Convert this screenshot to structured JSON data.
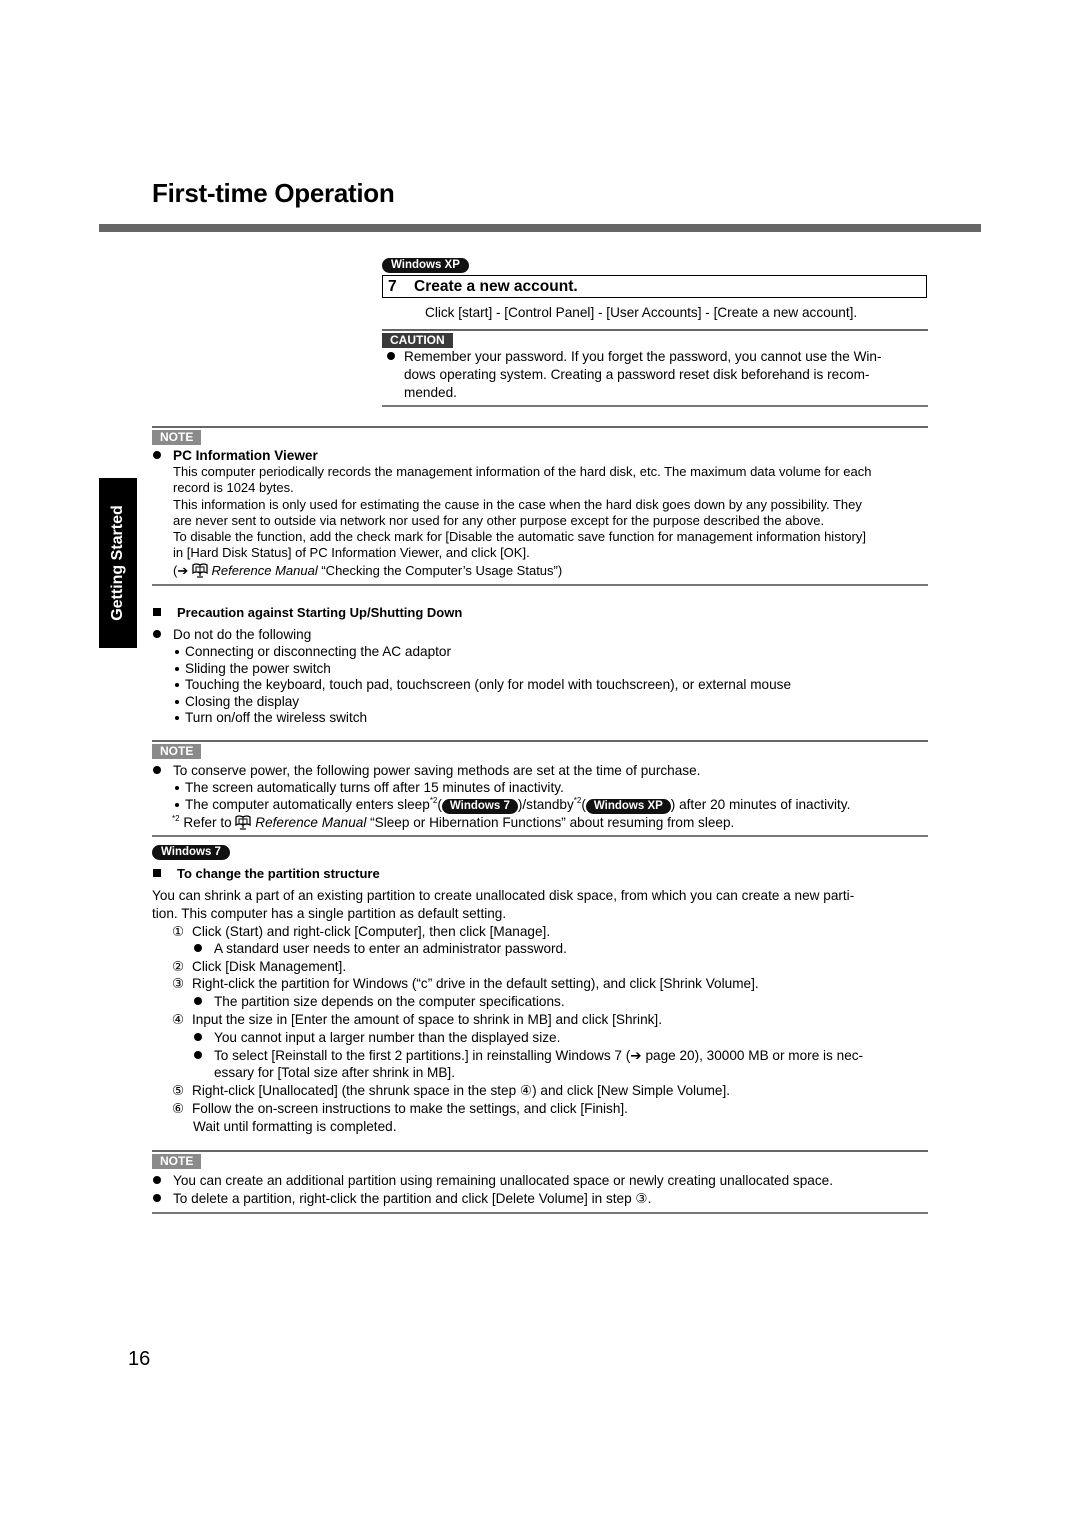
{
  "page": {
    "title": "First-time Operation",
    "side_tab": "Getting Started",
    "page_number": "16"
  },
  "badges": {
    "windows_xp": "Windows XP",
    "windows_7": "Windows 7"
  },
  "step7": {
    "number": "7",
    "title": "Create a new account.",
    "instruction": "Click [start] - [Control Panel] - [User Accounts] - [Create a new account]."
  },
  "caution": {
    "label": "CAUTION",
    "lines": [
      "Remember your password. If you forget the password, you cannot use the Win-",
      "dows operating system. Creating a password reset disk beforehand is recom-",
      "mended."
    ]
  },
  "note1": {
    "label": "NOTE",
    "heading": "PC Information Viewer",
    "lines": [
      "This computer periodically records the management information of the hard disk, etc. The maximum data volume for each",
      "record is 1024 bytes.",
      "This information is only used for estimating the cause in the case when the hard disk goes down by any possibility. They",
      "are never sent to outside via network nor used for any other purpose except for the purpose described the above.",
      "To disable the function, add the check mark for [Disable the automatic save function for management information history]",
      "in [Hard Disk Status] of PC Information Viewer, and click [OK]."
    ],
    "ref_open": "(",
    "ref_arrow": "➔",
    "ref_manual": "Reference Manual",
    "ref_topic": " “Checking the Computer’s Usage Status”)"
  },
  "precaution": {
    "heading": "Precaution against Starting Up/Shutting Down",
    "intro": "Do not do the following",
    "items": [
      "Connecting or disconnecting the AC adaptor",
      "Sliding the power switch",
      "Touching the keyboard, touch pad, touchscreen (only for model with touchscreen), or external mouse",
      "Closing the display",
      "Turn on/off the wireless switch"
    ]
  },
  "note2": {
    "label": "NOTE",
    "intro": "To conserve power, the following power saving methods are set at the time of purchase.",
    "item1": "The screen automatically turns off after 15 minutes of inactivity.",
    "item2_a": "The computer automatically enters sleep",
    "item2_sup": "*2",
    "item2_b": "(",
    "item2_c": ")/standby",
    "item2_d": "(",
    "item2_e": ") after 20 minutes of inactivity.",
    "footnote_mark": "*2",
    "footnote_a": " Refer to ",
    "footnote_manual": "Reference Manual",
    "footnote_b": " “Sleep or Hibernation Functions” about resuming from sleep."
  },
  "partition": {
    "heading": "To change the partition structure",
    "intro_lines": [
      "You can shrink a part of an existing partition to create unallocated disk space, from which you can create a new parti-",
      "tion. This computer has a single partition as default setting."
    ],
    "steps": [
      {
        "num": "①",
        "text": "Click      (Start) and right-click [Computer], then click [Manage]."
      },
      {
        "num": "",
        "bullet": "A standard user needs to enter an administrator password."
      },
      {
        "num": "②",
        "text": "Click [Disk Management]."
      },
      {
        "num": "③",
        "text": "Right-click the partition for Windows (“c” drive in the default setting), and click [Shrink Volume]."
      },
      {
        "num": "",
        "bullet": "The partition size depends on the computer specifications."
      },
      {
        "num": "④",
        "text": "Input the size in [Enter the amount of space to shrink in MB] and click [Shrink]."
      },
      {
        "num": "",
        "bullet": "You cannot input a larger number than the displayed size."
      },
      {
        "num": "",
        "bullet": "To select [Reinstall to the first 2 partitions.] in reinstalling Windows 7 (➔ page 20), 30000 MB or more is nec-"
      },
      {
        "num": "",
        "cont": "essary for [Total size after shrink in MB]."
      },
      {
        "num": "⑤",
        "text": "Right-click [Unallocated] (the shrunk space in the step ④) and click [New Simple Volume]."
      },
      {
        "num": "⑥",
        "text": "Follow the on-screen instructions to make the settings, and click [Finish]."
      },
      {
        "num": "",
        "cont": "Wait until formatting is completed."
      }
    ]
  },
  "note3": {
    "label": "NOTE",
    "items": [
      "You can create an additional partition using remaining unallocated space or newly creating unallocated space.",
      "To delete a partition, right-click the partition and click [Delete Volume] in step ③."
    ]
  }
}
